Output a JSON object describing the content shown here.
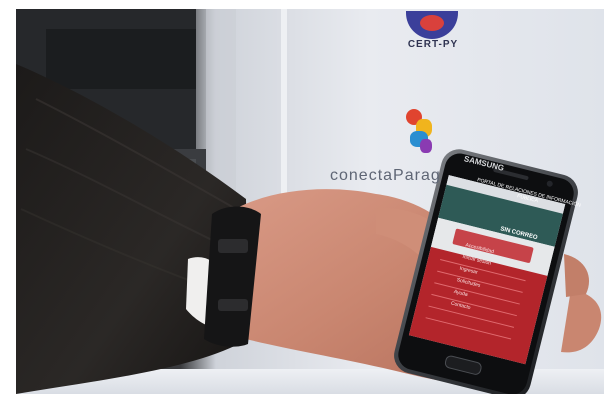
{
  "scene": {
    "description_type": "photo",
    "background_colors": {
      "dark_left": "#2b2b2e",
      "backdrop": "#e8eaef",
      "table": "#e3e6ec"
    }
  },
  "backdrop": {
    "logo_top": {
      "text": "CERT-PY",
      "icon": "cert-py-shield-icon"
    },
    "logo_mid": {
      "text": "conectaParag",
      "icon": "conecta-paraguay-map-icon"
    }
  },
  "phone": {
    "brand": "SAMSUNG",
    "screen": {
      "header_text": "PORTAL DE RELACIONES DE INFORMACIÓN PÚBLICA",
      "banner_text": "SIN CORREO",
      "accent": "#c0262d",
      "nav_items": [
        "Accesibilidad",
        "Iniciar sesión",
        "Ingresar",
        "Solicitudes",
        "Ayuda",
        "Contacto"
      ]
    }
  }
}
